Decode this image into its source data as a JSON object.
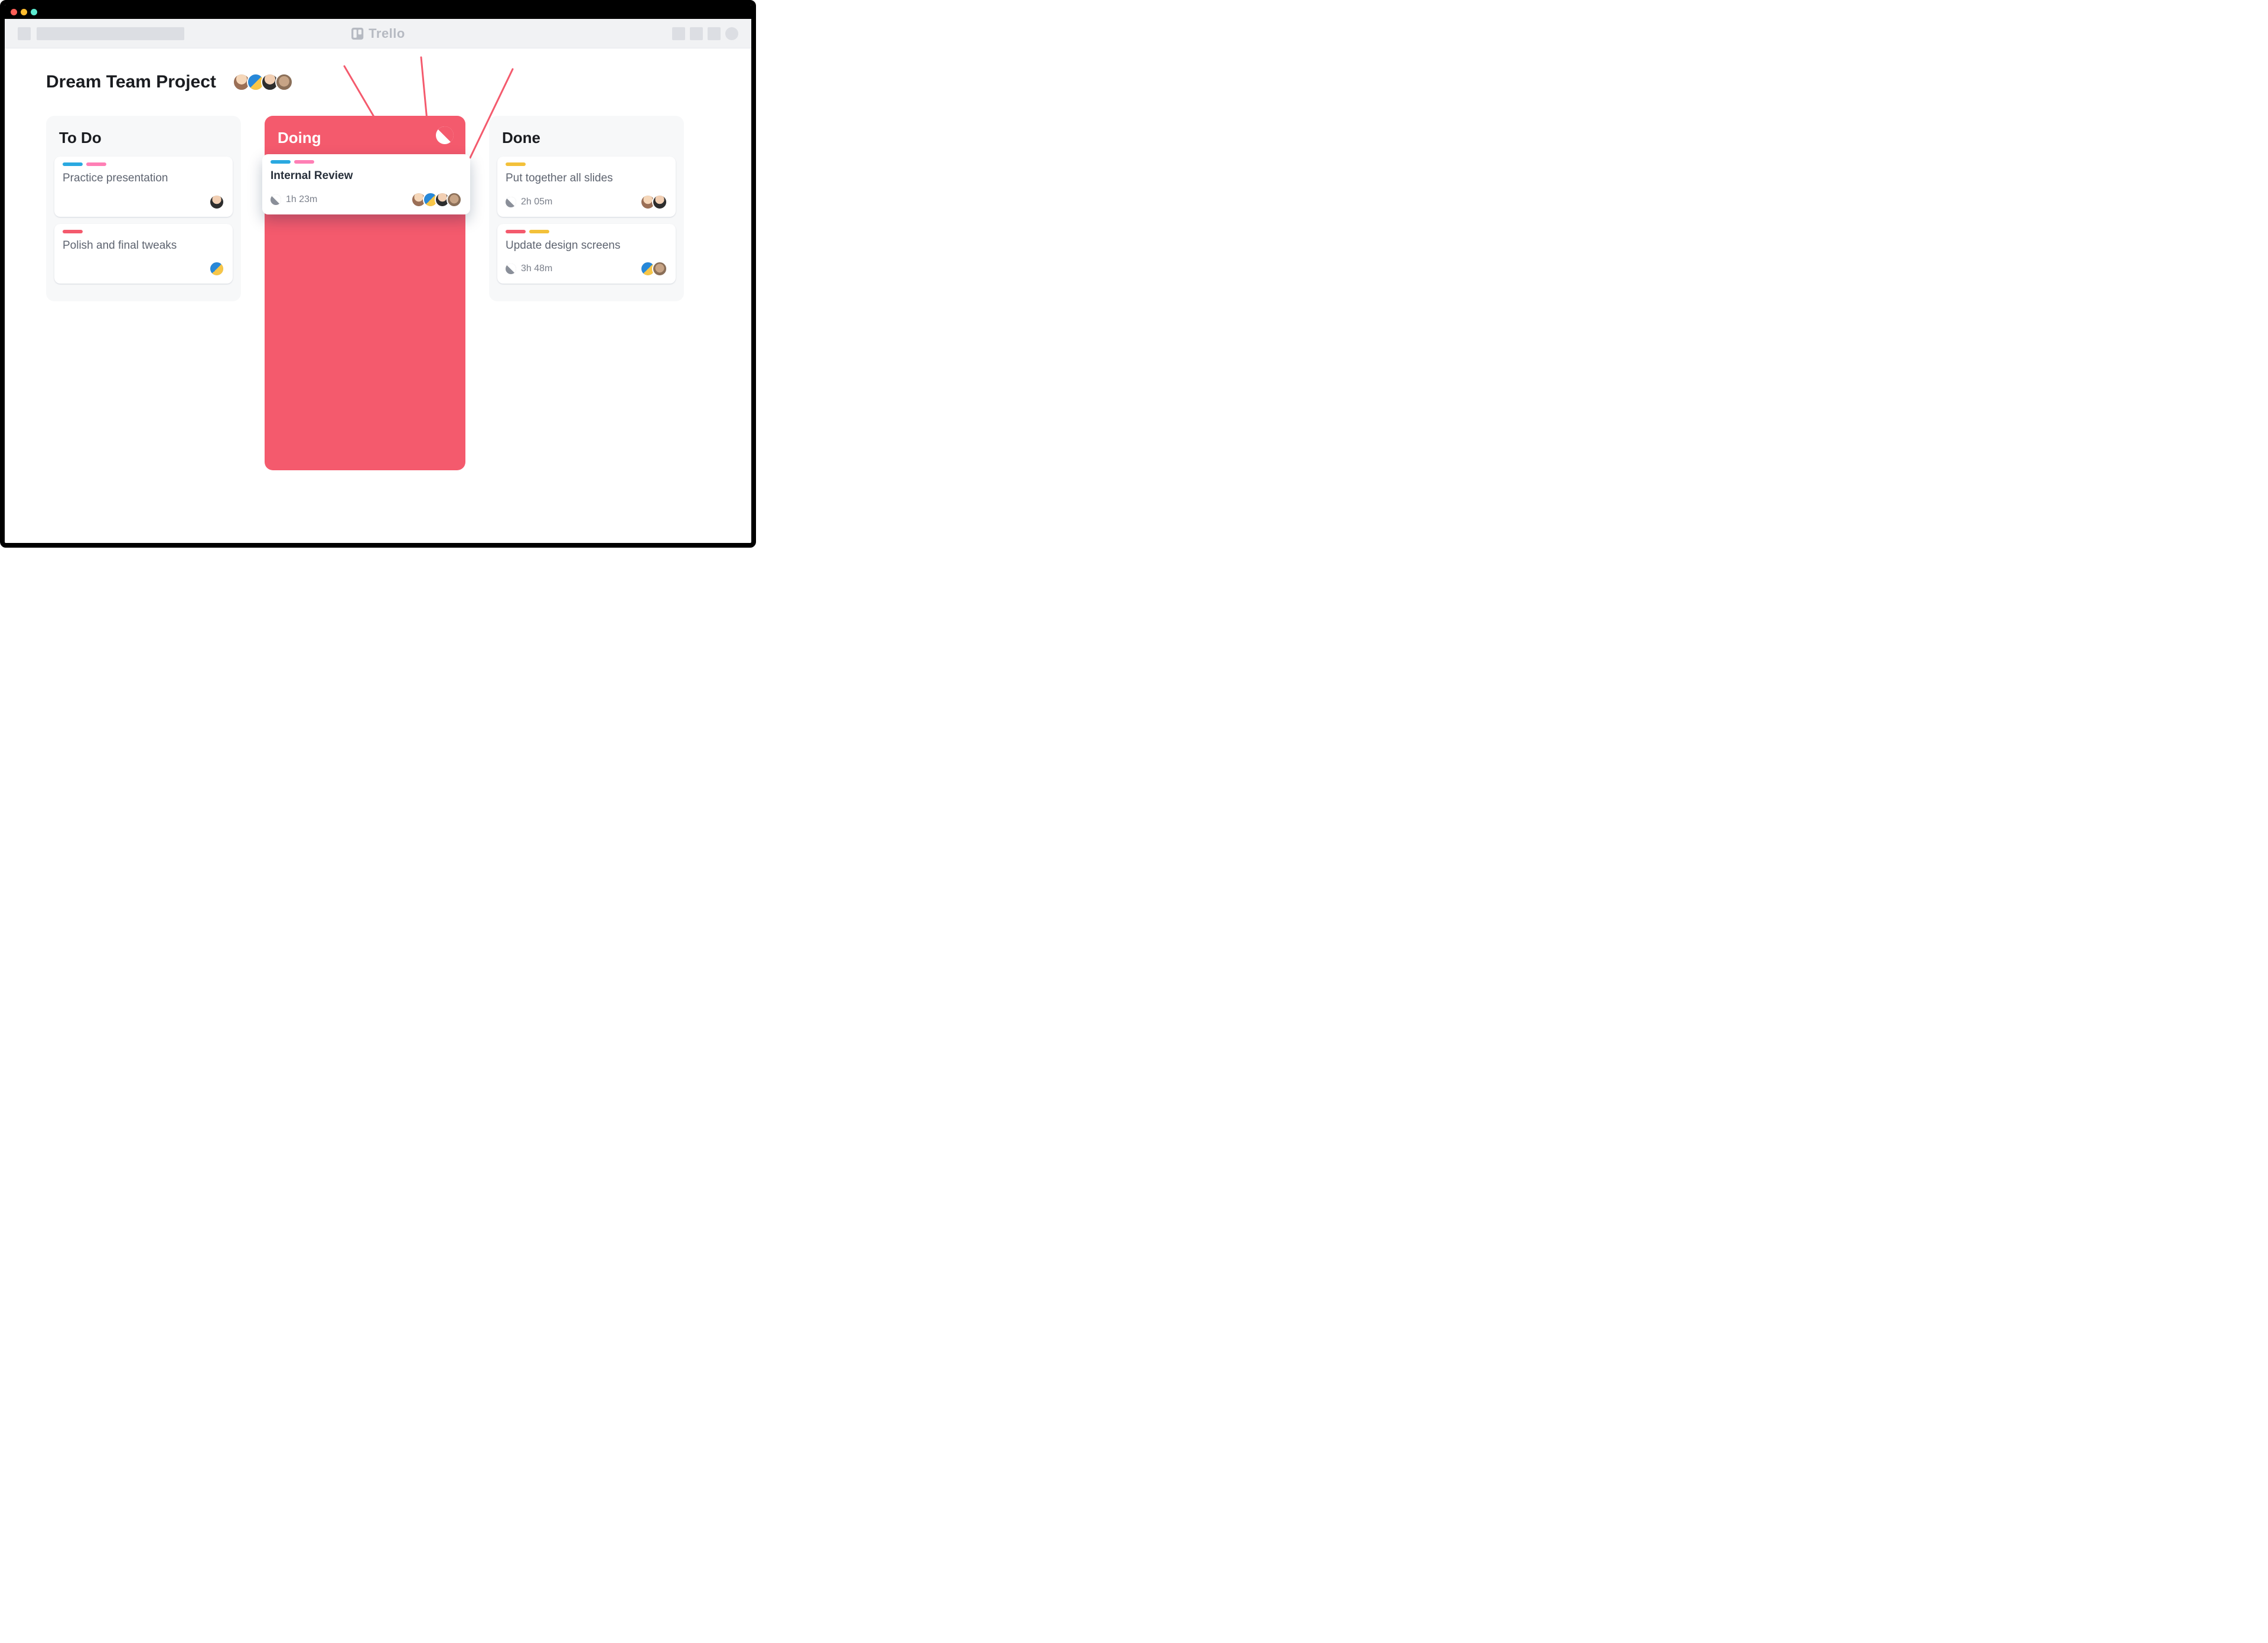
{
  "app": {
    "name": "Trello"
  },
  "board": {
    "title": "Dream Team Project",
    "members": [
      "member-1",
      "member-2",
      "member-3",
      "member-4"
    ]
  },
  "colors": {
    "accent": "#f45a6d",
    "label_blue": "#2aa9e0",
    "label_pink": "#ff7fb5",
    "label_coral": "#f45a6d",
    "label_yellow": "#f3c13a"
  },
  "lists": [
    {
      "id": "todo",
      "title": "To Do",
      "accent": false,
      "cards": [
        {
          "labels": [
            "blue",
            "pink"
          ],
          "title": "Practice presentation",
          "time": null,
          "members": [
            "member-3"
          ]
        },
        {
          "labels": [
            "coral"
          ],
          "title": "Polish and final tweaks",
          "time": null,
          "members": [
            "member-2"
          ]
        }
      ]
    },
    {
      "id": "doing",
      "title": "Doing",
      "accent": true,
      "powerup_icon": "activity-timer-icon",
      "cards": [
        {
          "labels": [
            "blue",
            "pink"
          ],
          "title": "Internal Review",
          "time": "1h 23m",
          "members": [
            "member-1",
            "member-2",
            "member-3",
            "member-4"
          ],
          "elevated": true
        }
      ]
    },
    {
      "id": "done",
      "title": "Done",
      "accent": false,
      "cards": [
        {
          "labels": [
            "yellow"
          ],
          "title": "Put together all slides",
          "time": "2h 05m",
          "members": [
            "member-1",
            "member-3"
          ]
        },
        {
          "labels": [
            "coral",
            "yellow"
          ],
          "title": "Update design screens",
          "time": "3h 48m",
          "members": [
            "member-2",
            "member-4"
          ]
        }
      ]
    }
  ]
}
